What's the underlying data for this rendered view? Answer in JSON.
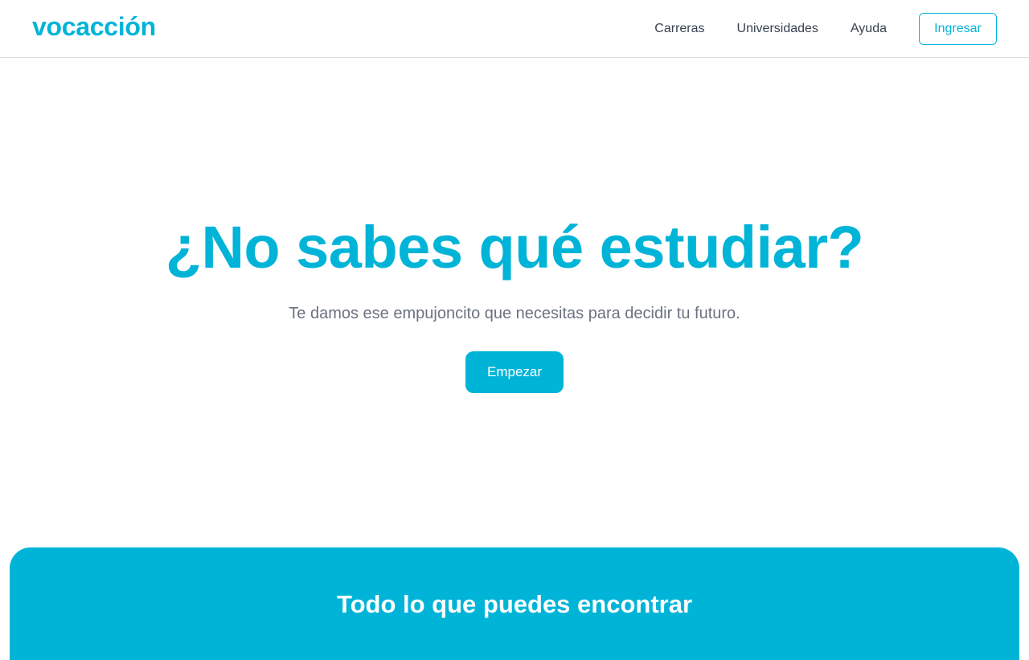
{
  "brand": {
    "name": "vocacción",
    "accent_color": "#00b4d8"
  },
  "nav": {
    "links": [
      {
        "label": "Carreras"
      },
      {
        "label": "Universidades"
      },
      {
        "label": "Ayuda"
      }
    ],
    "login_label": "Ingresar"
  },
  "hero": {
    "title": "¿No sabes qué estudiar?",
    "subtitle": "Te damos ese empujoncito que necesitas para decidir tu futuro.",
    "cta_label": "Empezar"
  },
  "features": {
    "title": "Todo lo que puedes encontrar"
  }
}
